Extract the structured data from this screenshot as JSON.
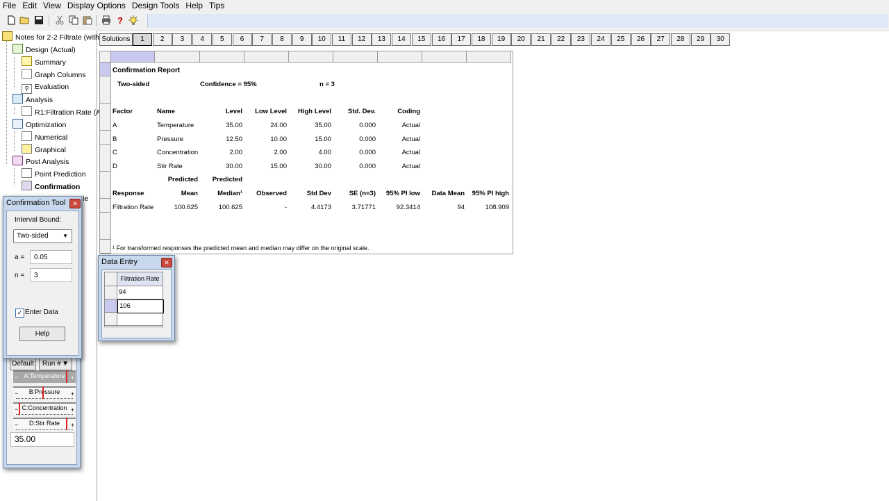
{
  "menu": [
    "File",
    "Edit",
    "View",
    "Display Options",
    "Design Tools",
    "Help",
    "Tips"
  ],
  "toolbar_icons": [
    "new-file-icon",
    "open-folder-icon",
    "save-icon",
    "cut-icon",
    "copy-icon",
    "paste-icon",
    "print-icon",
    "help-question-icon",
    "tip-lightbulb-icon"
  ],
  "tree": {
    "root": "Notes for 2-2 Filtrate (with",
    "design": "Design (Actual)",
    "summary": "Summary",
    "graph_columns": "Graph Columns",
    "evaluation": "Evaluation",
    "analysis": "Analysis",
    "r1": "R1:Filtration Rate (A",
    "optimization": "Optimization",
    "numerical": "Numerical",
    "graphical": "Graphical",
    "post_analysis": "Post Analysis",
    "point_prediction": "Point Prediction",
    "confirmation": "Confirmation",
    "hidden_item_tail": "le"
  },
  "solutions": {
    "label": "Solutions",
    "tabs": [
      "1",
      "2",
      "3",
      "4",
      "5",
      "6",
      "7",
      "8",
      "9",
      "10",
      "11",
      "12",
      "13",
      "14",
      "15",
      "16",
      "17",
      "18",
      "19",
      "20",
      "21",
      "22",
      "23",
      "24",
      "25",
      "26",
      "27",
      "28",
      "29",
      "30"
    ],
    "active": "1"
  },
  "report": {
    "title": "Confirmation Report",
    "sided": "Two-sided",
    "confidence": "Confidence = 95%",
    "n": "n =  3",
    "factor_headers": [
      "Factor",
      "Name",
      "Level",
      "Low Level",
      "High Level",
      "Std. Dev.",
      "Coding"
    ],
    "factors": [
      [
        "A",
        "Temperature",
        "35.00",
        "24.00",
        "35.00",
        "0.000",
        "Actual"
      ],
      [
        "B",
        "Pressure",
        "12.50",
        "10.00",
        "15.00",
        "0.000",
        "Actual"
      ],
      [
        "C",
        "Concentration",
        "2.00",
        "2.00",
        "4.00",
        "0.000",
        "Actual"
      ],
      [
        "D",
        "Stir Rate",
        "30.00",
        "15.00",
        "30.00",
        "0.000",
        "Actual"
      ]
    ],
    "predicted_1": "Predicted",
    "predicted_2": "Predicted",
    "response_headers": [
      "Response",
      "Mean",
      "Median¹",
      "Observed",
      "Std Dev",
      "SE (n=3)",
      "95% PI low",
      "Data Mean",
      "95% PI high"
    ],
    "response_row": [
      "Filtration Rate",
      "100.625",
      "100.625",
      "-",
      "4.4173",
      "3.71771",
      "92.3414",
      "94",
      "108.909"
    ],
    "footnote": "¹ For transformed responses the predicted mean and median may differ on the original scale."
  },
  "confirmation_tool": {
    "title": "Confirmation Tool",
    "interval_label": "Interval Bound:",
    "interval_value": "Two-sided",
    "alpha_label": "a =",
    "alpha_value": "0.05",
    "n_label": "n =",
    "n_value": "3",
    "enter_data_label": "Enter Data",
    "enter_data_checked": true,
    "help_label": "Help"
  },
  "data_entry": {
    "title": "Data Entry",
    "column": "Filtration Rate",
    "values": [
      "94",
      "106",
      ""
    ]
  },
  "factors_tool": {
    "default_label": "Default",
    "run_label": "Run #",
    "sliders": [
      {
        "label": "A:Temperature",
        "level": 1.0
      },
      {
        "label": "B:Pressure",
        "level": 0.5
      },
      {
        "label": "C:Concentration",
        "level": 0.0
      },
      {
        "label": "D:Stir Rate",
        "level": 1.0
      }
    ],
    "value": "35.00"
  },
  "colors": {
    "menu_bg": "#f0f0f0",
    "window_frame": "#c8d8ec",
    "close_button": "#c9463d",
    "slider_marker": "#e02020"
  }
}
